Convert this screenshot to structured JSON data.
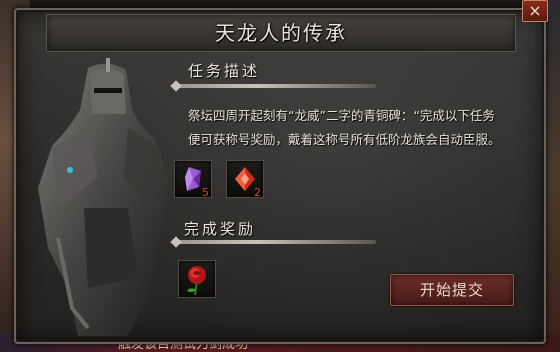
{
  "window": {
    "title": "天龙人的传承",
    "close_label": "×"
  },
  "task": {
    "heading": "任务描述",
    "line1": "祭坛四周开起刻有“龙威”二字的青铜碑：“完成以下任务",
    "line2": "便可获称号奖励，戴着这称号所有低阶龙族会自动臣服。",
    "items": [
      {
        "icon": "purple-crystal-icon",
        "count": "5"
      },
      {
        "icon": "red-gem-icon",
        "count": "2"
      }
    ]
  },
  "reward": {
    "heading": "完成奖励",
    "items": [
      {
        "icon": "red-rose-icon"
      }
    ]
  },
  "actions": {
    "start_label": "开始提交"
  },
  "background": {
    "bottom_text": "触发该目测试刀剑成功"
  },
  "colors": {
    "accent_red": "#e04030",
    "title_text": "#e8e4d8"
  }
}
